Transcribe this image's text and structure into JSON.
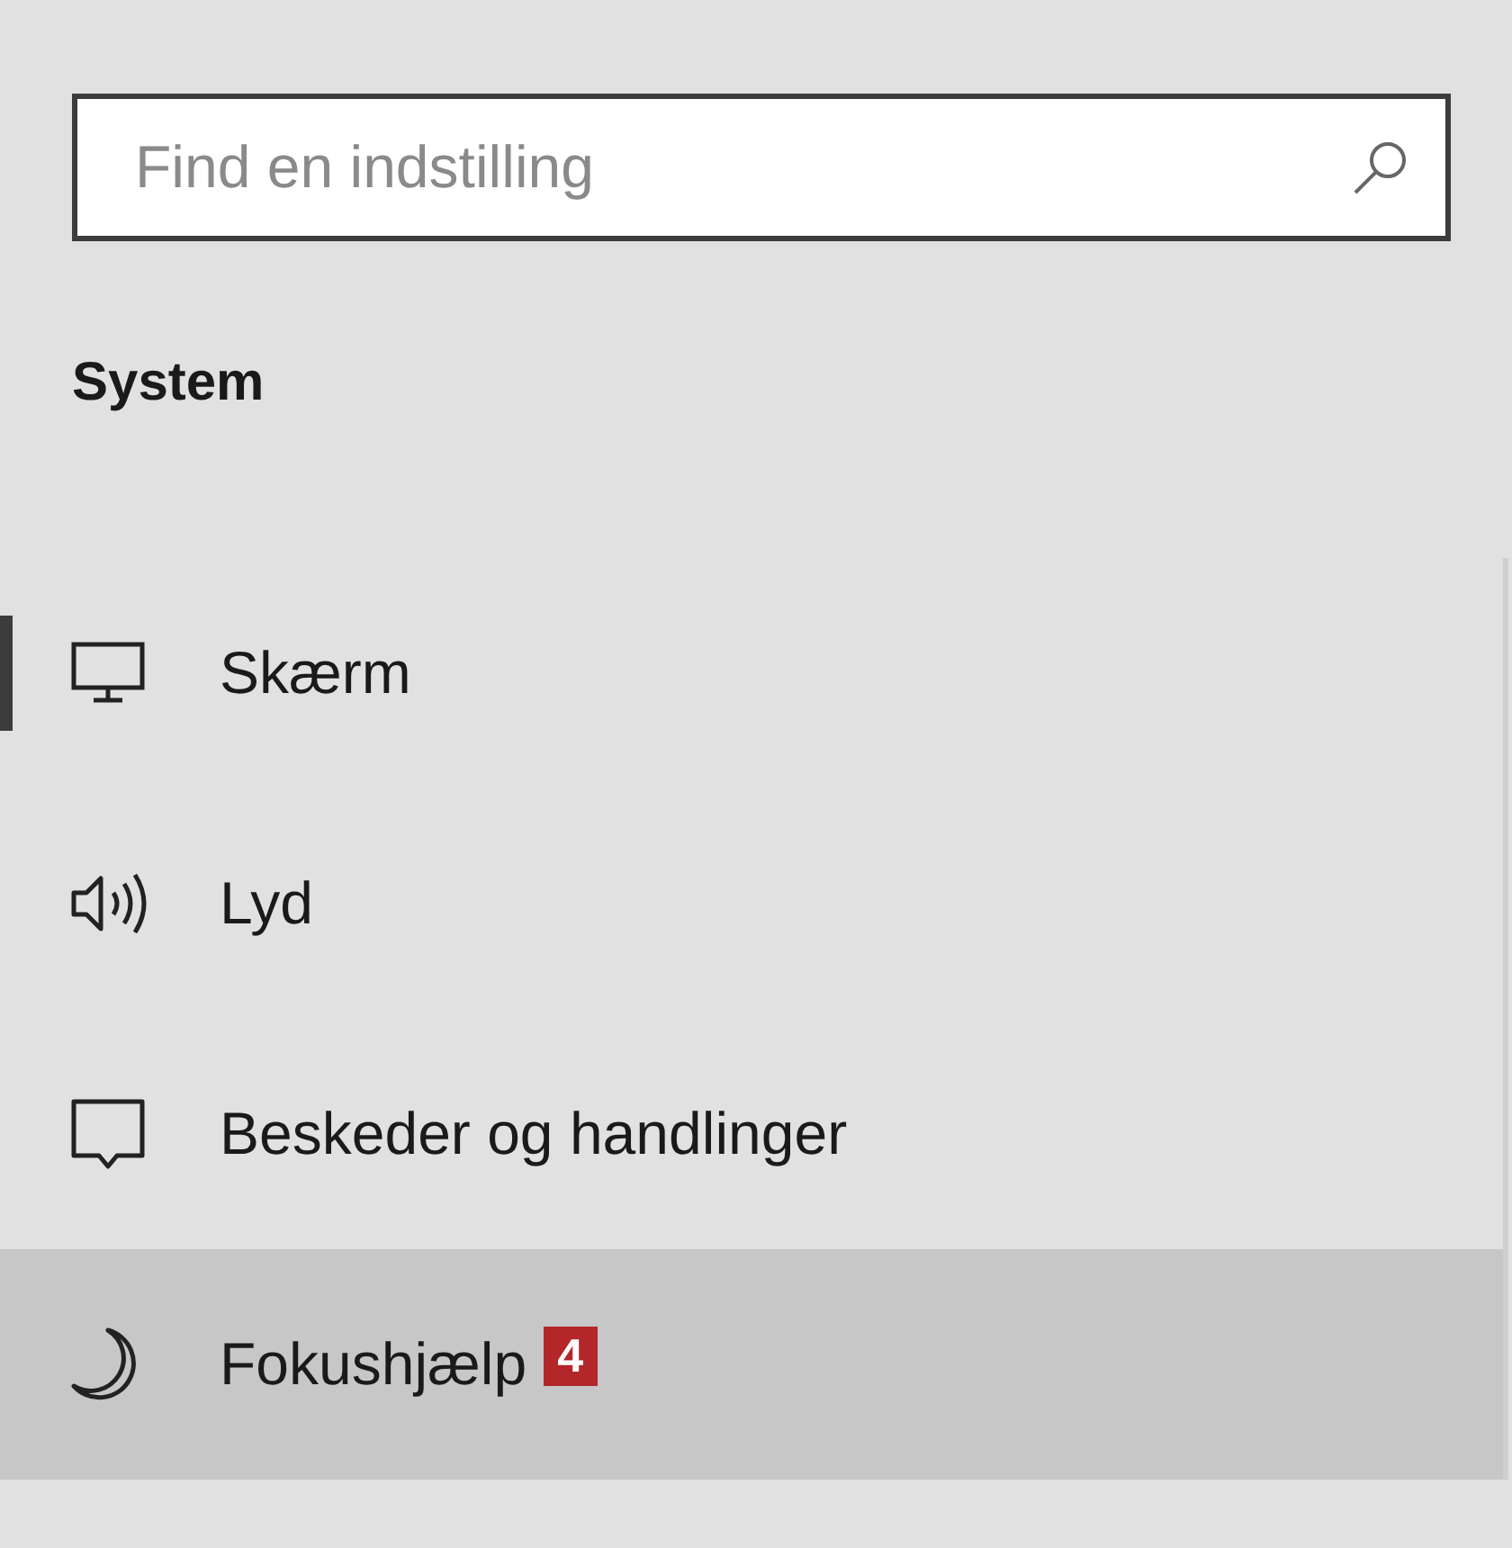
{
  "search": {
    "placeholder": "Find en indstilling"
  },
  "heading": "System",
  "nav_items": [
    {
      "label": "Skærm",
      "selected": true,
      "hovered": false
    },
    {
      "label": "Lyd",
      "selected": false,
      "hovered": false
    },
    {
      "label": "Beskeder og handlinger",
      "selected": false,
      "hovered": false
    },
    {
      "label": "Fokushjælp",
      "selected": false,
      "hovered": true,
      "badge": "4"
    }
  ]
}
